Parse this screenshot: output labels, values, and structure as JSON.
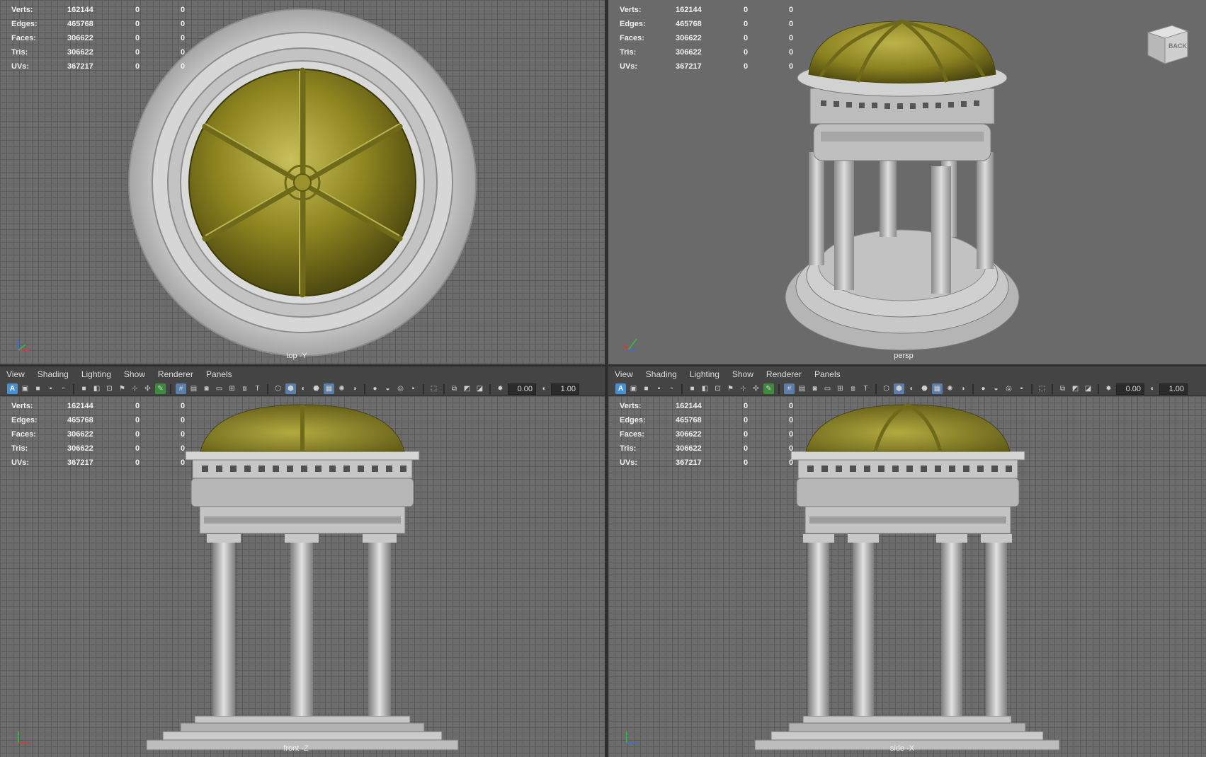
{
  "hud": {
    "rows": [
      {
        "label": "Verts:",
        "v1": "162144",
        "v2": "0",
        "v3": "0"
      },
      {
        "label": "Edges:",
        "v1": "465768",
        "v2": "0",
        "v3": "0"
      },
      {
        "label": "Faces:",
        "v1": "306622",
        "v2": "0",
        "v3": "0"
      },
      {
        "label": "Tris:",
        "v1": "306622",
        "v2": "0",
        "v3": "0"
      },
      {
        "label": "UVs:",
        "v1": "367217",
        "v2": "0",
        "v3": "0"
      }
    ]
  },
  "menu": [
    "View",
    "Shading",
    "Lighting",
    "Show",
    "Renderer",
    "Panels"
  ],
  "toolbar": {
    "field1": "0.00",
    "field2": "1.00"
  },
  "viewports": {
    "top": {
      "camera": "top -Y"
    },
    "persp": {
      "camera": "persp",
      "viewcube": "BACK"
    },
    "front": {
      "camera": "front -Z"
    },
    "side": {
      "camera": "side -X"
    }
  },
  "colors": {
    "dome": "#8a8120",
    "marble": "#c9c9c9",
    "grid": "#6c6c6c"
  }
}
